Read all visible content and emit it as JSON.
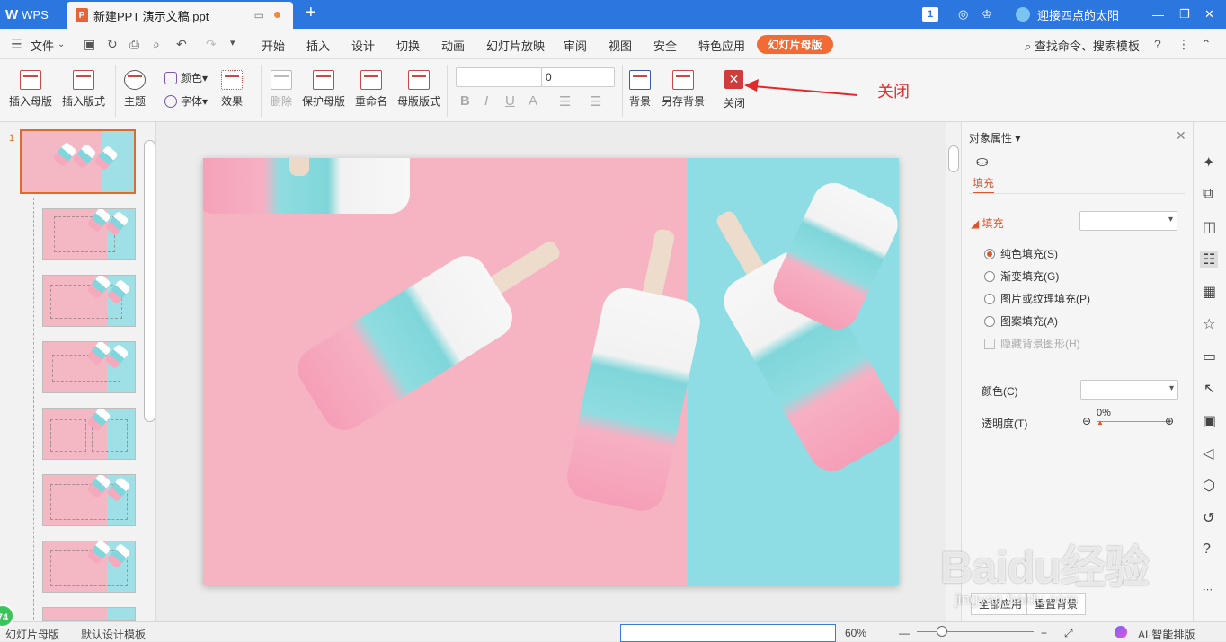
{
  "titlebar": {
    "app": "WPS",
    "doc_tab": "新建PPT 演示文稿.ppt",
    "badge": "1",
    "user": "迎接四点的太阳"
  },
  "menubar": {
    "file": "文件",
    "tabs": [
      "开始",
      "插入",
      "设计",
      "切换",
      "动画",
      "幻灯片放映",
      "审阅",
      "视图",
      "安全",
      "特色应用"
    ],
    "active_tab": "幻灯片母版",
    "search": "查找命令、搜索模板"
  },
  "ribbon": {
    "insert_master": "插入母版",
    "insert_layout": "插入版式",
    "theme": "主题",
    "color": "颜色",
    "font": "字体",
    "effect": "效果",
    "delete": "删除",
    "protect_master": "保护母版",
    "rename": "重命名",
    "master_layout": "母版版式",
    "font_name": "",
    "font_size": "0",
    "bold": "B",
    "italic": "I",
    "underline": "U",
    "fontcolor": "A",
    "background": "背景",
    "save_background": "另存背景",
    "close": "关闭"
  },
  "annotation": "关闭",
  "thumbs": {
    "first_index": "1"
  },
  "props": {
    "panel_title": "对象属性",
    "tab_fill": "填充",
    "section_fill": "填充",
    "options": [
      "纯色填充(S)",
      "渐变填充(G)",
      "图片或纹理填充(P)",
      "图案填充(A)"
    ],
    "hide_bg": "隐藏背景图形(H)",
    "color_label": "颜色(C)",
    "transparency_label": "透明度(T)",
    "transparency_value": "0%",
    "apply_all": "全部应用",
    "reset": "重置背景"
  },
  "statusbar": {
    "left1": "幻灯片母版",
    "left2": "默认设计模板",
    "zoom": "60%",
    "ai": "AI·智能排版",
    "badge": "74"
  },
  "watermark": "Baidu经验",
  "watermark_url": "jingyan.baidu.com"
}
